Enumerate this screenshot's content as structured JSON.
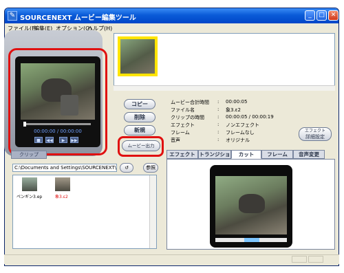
{
  "window": {
    "title": "SOURCENEXT ムービー編集ツール",
    "icon_glyph": "✎"
  },
  "title_buttons": {
    "minimize": "_",
    "maximize": "□",
    "close": "✕"
  },
  "menu": [
    "ファイル(F)",
    "編集(E)",
    "オプション(O)",
    "ヘルプ(H)"
  ],
  "player": {
    "time": "00:00:00 / 00:00:00",
    "controls": [
      "■",
      "◀◀",
      "▶",
      "▶▶"
    ]
  },
  "left_tab": {
    "label": "クリップ"
  },
  "path": {
    "value": "C:\\Documents and Settings\\SOURCENEXT\\M",
    "icon_glyph": "↺",
    "browse_label": "参照"
  },
  "files": [
    {
      "name": "ペンギン3.ep",
      "color": "#000000"
    },
    {
      "name": "象3.ε2",
      "color": "#e01010"
    }
  ],
  "buttons": {
    "copy": "コピー",
    "delete": "削除",
    "new": "新規",
    "export": "ムービー出力",
    "detail_line1": "エフェクト",
    "detail_line2": "詳細設定"
  },
  "info": {
    "rows": [
      {
        "label": "ムービー合計時間",
        "value": "00:00:05"
      },
      {
        "label": "ファイル名",
        "value": "象3.ε2"
      },
      {
        "label": "クリップの時間",
        "value": "00:00:05 / 00:00:19"
      },
      {
        "label": "エフェクト",
        "value": "ノンエフェクト"
      },
      {
        "label": "フレーム",
        "value": "フレームなし"
      },
      {
        "label": "音声",
        "value": "オリジナル"
      }
    ]
  },
  "tabs": [
    "エフェクト",
    "トランジション",
    "カット",
    "フレーム",
    "音声変更"
  ],
  "active_tab": "カット",
  "colors": {
    "highlight": "#e01010",
    "titlebar": "#0a5bd8",
    "clip_border": "#ffe400"
  }
}
